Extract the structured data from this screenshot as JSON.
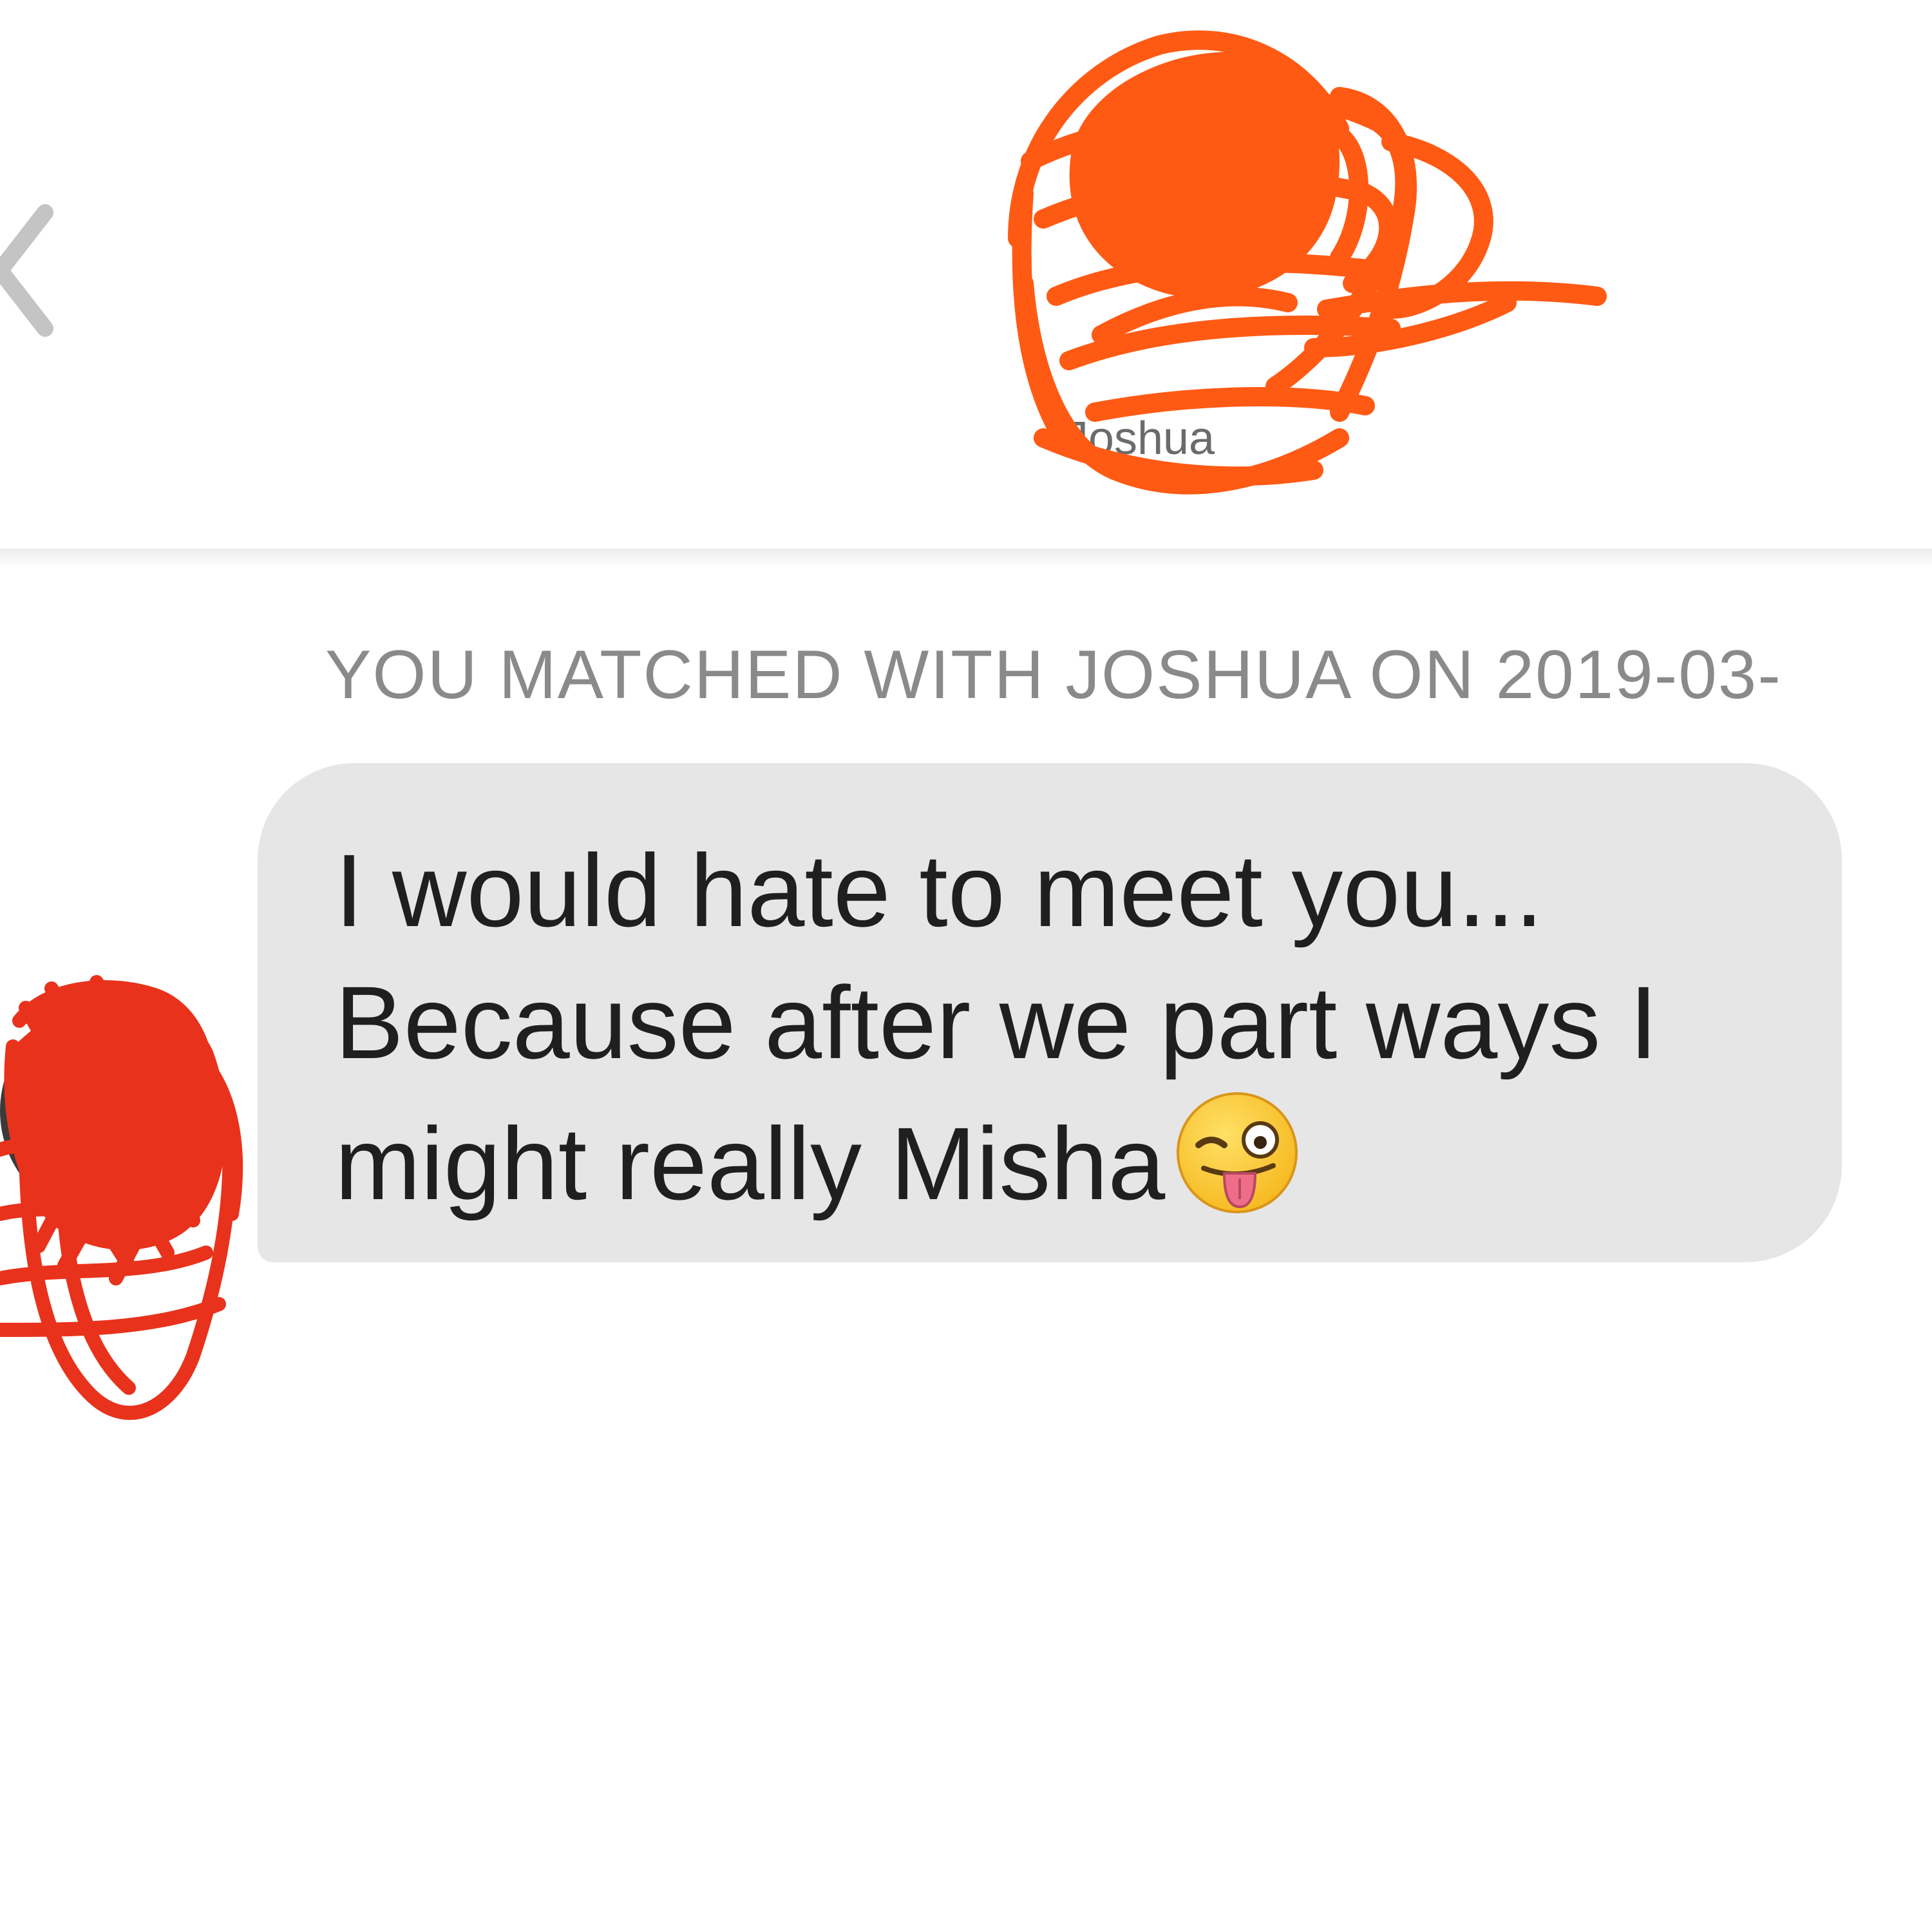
{
  "header": {
    "back_icon": "chevron-left-icon",
    "profile_name": "Joshua",
    "profile_redaction_color": "#ff5a14"
  },
  "conversation": {
    "match_notice": "YOU MATCHED WITH JOSHUA ON 2019-03-",
    "messages": [
      {
        "lines": [
          "I would hate to meet you...",
          "Because after we part ways I",
          "might really Misha"
        ],
        "emoji": "winking-face-with-tongue-icon",
        "bubble_color": "#e6e6e6"
      }
    ],
    "avatar_redaction_color": "#e8321c"
  }
}
